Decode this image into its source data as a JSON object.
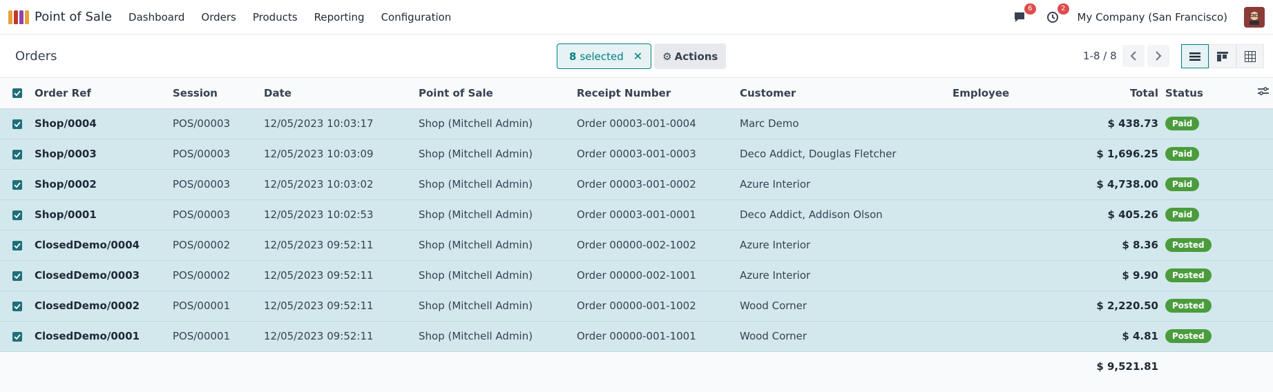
{
  "nav": {
    "app_name": "Point of Sale",
    "menu": [
      "Dashboard",
      "Orders",
      "Products",
      "Reporting",
      "Configuration"
    ],
    "messages_badge": "6",
    "activity_badge": "2",
    "company": "My Company (San Francisco)"
  },
  "control": {
    "title": "Orders",
    "selected_count": "8",
    "selected_label": "selected",
    "actions_label": "Actions",
    "pager": "1-8 / 8"
  },
  "table": {
    "headers": {
      "order_ref": "Order Ref",
      "session": "Session",
      "date": "Date",
      "pos": "Point of Sale",
      "receipt": "Receipt Number",
      "customer": "Customer",
      "employee": "Employee",
      "total": "Total",
      "status": "Status"
    },
    "rows": [
      {
        "ref": "Shop/0004",
        "session": "POS/00003",
        "date": "12/05/2023 10:03:17",
        "pos": "Shop (Mitchell Admin)",
        "receipt": "Order 00003-001-0004",
        "customer": "Marc Demo",
        "employee": "",
        "total": "$ 438.73",
        "status": "Paid"
      },
      {
        "ref": "Shop/0003",
        "session": "POS/00003",
        "date": "12/05/2023 10:03:09",
        "pos": "Shop (Mitchell Admin)",
        "receipt": "Order 00003-001-0003",
        "customer": "Deco Addict, Douglas Fletcher",
        "employee": "",
        "total": "$ 1,696.25",
        "status": "Paid"
      },
      {
        "ref": "Shop/0002",
        "session": "POS/00003",
        "date": "12/05/2023 10:03:02",
        "pos": "Shop (Mitchell Admin)",
        "receipt": "Order 00003-001-0002",
        "customer": "Azure Interior",
        "employee": "",
        "total": "$ 4,738.00",
        "status": "Paid"
      },
      {
        "ref": "Shop/0001",
        "session": "POS/00003",
        "date": "12/05/2023 10:02:53",
        "pos": "Shop (Mitchell Admin)",
        "receipt": "Order 00003-001-0001",
        "customer": "Deco Addict, Addison Olson",
        "employee": "",
        "total": "$ 405.26",
        "status": "Paid"
      },
      {
        "ref": "ClosedDemo/0004",
        "session": "POS/00002",
        "date": "12/05/2023 09:52:11",
        "pos": "Shop (Mitchell Admin)",
        "receipt": "Order 00000-002-1002",
        "customer": "Azure Interior",
        "employee": "",
        "total": "$ 8.36",
        "status": "Posted"
      },
      {
        "ref": "ClosedDemo/0003",
        "session": "POS/00002",
        "date": "12/05/2023 09:52:11",
        "pos": "Shop (Mitchell Admin)",
        "receipt": "Order 00000-002-1001",
        "customer": "Azure Interior",
        "employee": "",
        "total": "$ 9.90",
        "status": "Posted"
      },
      {
        "ref": "ClosedDemo/0002",
        "session": "POS/00001",
        "date": "12/05/2023 09:52:11",
        "pos": "Shop (Mitchell Admin)",
        "receipt": "Order 00000-001-1002",
        "customer": "Wood Corner",
        "employee": "",
        "total": "$ 2,220.50",
        "status": "Posted"
      },
      {
        "ref": "ClosedDemo/0001",
        "session": "POS/00001",
        "date": "12/05/2023 09:52:11",
        "pos": "Shop (Mitchell Admin)",
        "receipt": "Order 00000-001-1001",
        "customer": "Wood Corner",
        "employee": "",
        "total": "$ 4.81",
        "status": "Posted"
      }
    ],
    "grand_total": "$ 9,521.81"
  },
  "colors": {
    "accent": "#017e84",
    "selected_row": "#d2e8ed",
    "status_green": "#4b9c3c",
    "badge_red": "#e04b4b"
  },
  "icons": [
    "pos-logo-icon",
    "chat-icon",
    "clock-icon",
    "gear-icon",
    "chevron-left-icon",
    "chevron-right-icon",
    "list-view-icon",
    "kanban-view-icon",
    "pivot-view-icon",
    "optional-columns-icon",
    "checkbox-checked-icon",
    "close-icon"
  ]
}
